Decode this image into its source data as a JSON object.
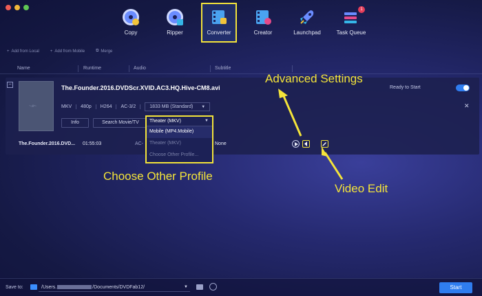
{
  "nav": {
    "items": [
      {
        "label": "Copy",
        "icon": "disc-copy-icon"
      },
      {
        "label": "Ripper",
        "icon": "disc-ripper-icon"
      },
      {
        "label": "Converter",
        "icon": "film-converter-icon"
      },
      {
        "label": "Creator",
        "icon": "film-creator-icon"
      },
      {
        "label": "Launchpad",
        "icon": "rocket-icon"
      },
      {
        "label": "Task Queue",
        "icon": "task-queue-icon"
      }
    ],
    "active": "Converter",
    "task_queue_badge": "1"
  },
  "toolbar": {
    "add_local": "Add from Local",
    "add_mobile": "Add from Mobile",
    "merge": "Merge"
  },
  "columns": {
    "name": "Name",
    "runtime": "Runtime",
    "audio": "Audio",
    "subtitle": "Subtitle"
  },
  "task": {
    "title": "The.Founder.2016.DVDScr.XVID.AC3.HQ.Hive-CM8.avi",
    "format": "MKV",
    "resolution": "480p",
    "codec": "H264",
    "audio": "AC-3/2",
    "size": "1833 MB (Standard)",
    "info_label": "Info",
    "search_label": "Search Movie/TV",
    "status": "Ready to Start",
    "enabled": true,
    "row": {
      "name": "The.Founder.2016.DVD...",
      "runtime": "01:55:03",
      "audio": "AC-",
      "subtitle": "None"
    }
  },
  "profile_dropdown": {
    "selected": "Theater (MKV)",
    "options": [
      "Mobile (MP4.Mobile)",
      "Theater (MKV)",
      "Choose Other Profile..."
    ]
  },
  "callouts": {
    "advanced": "Advanced Settings",
    "choose_profile": "Choose Other Profile",
    "video_edit": "Video Edit"
  },
  "bottom": {
    "save_label": "Save to:",
    "path_prefix": "/Users.",
    "path_suffix": "/Documents/DVDFab12/",
    "start_label": "Start"
  },
  "colors": {
    "accent": "#2f7df0",
    "highlight": "#f4e43a"
  }
}
